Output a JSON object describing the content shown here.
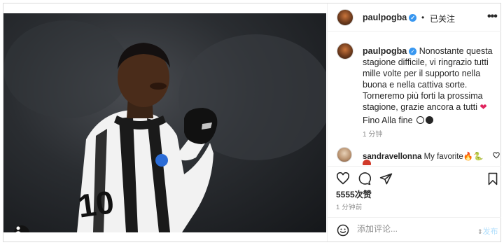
{
  "colors": {
    "accent": "#3897f0",
    "muted_text": "#8e8e8e",
    "border": "#dbdbdb",
    "heart": "#e0245e"
  },
  "photo": {
    "icon": "user-tag-icon"
  },
  "header": {
    "username": "paulpogba",
    "separator": "•",
    "follow_state": "已关注",
    "more_icon": "more-horizontal-icon"
  },
  "caption": {
    "username": "paulpogba",
    "text": "Nonostante questa stagione difficile, vi ringrazio tutti mille volte per il supporto nella buona e nella cattiva sorte. Torneremo più forti la prossima stagione, grazie ancora a tutti",
    "heart": "❤",
    "tail": "Fino Alla fine",
    "time": "1 分钟"
  },
  "comment": {
    "username": "sandravellonna",
    "text": "My favorite🔥🐍",
    "like_icon": "heart-outline-icon"
  },
  "actions": {
    "icons": [
      "heart-outline-icon",
      "comment-icon",
      "share-icon",
      "bookmark-icon"
    ]
  },
  "likes": "5555次赞",
  "post_time": "1 分钟前",
  "comment_bar": {
    "icon": "smile-icon",
    "placeholder": "添加评论...",
    "post_label": "发布"
  }
}
